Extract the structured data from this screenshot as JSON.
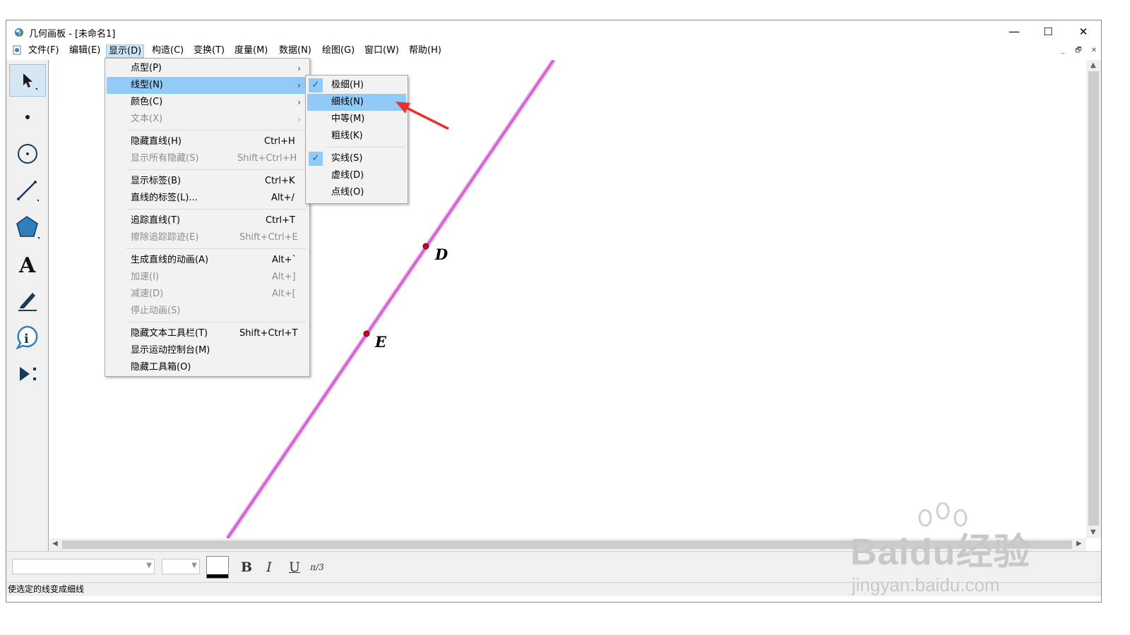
{
  "window": {
    "title": "几何画板 - [未命名1]"
  },
  "window_controls": {
    "minimize": "—",
    "maximize": "☐",
    "close": "✕"
  },
  "menubar": {
    "items": [
      "文件(F)",
      "编辑(E)",
      "显示(D)",
      "构造(C)",
      "变换(T)",
      "度量(M)",
      "数据(N)",
      "绘图(G)",
      "窗口(W)",
      "帮助(H)"
    ],
    "active_index": 2,
    "mdi_controls": [
      "_",
      "🗗",
      "✕"
    ]
  },
  "toolbox": {
    "tools": [
      "arrow-select-tool",
      "point-tool",
      "compass-tool",
      "straightedge-tool",
      "polygon-tool",
      "text-tool",
      "marker-tool",
      "information-tool",
      "custom-tool"
    ],
    "selected_index": 0
  },
  "display_menu": {
    "items": [
      {
        "label": "点型(P)",
        "shortcut": "",
        "submenu": true,
        "enabled": true
      },
      {
        "label": "线型(N)",
        "shortcut": "",
        "submenu": true,
        "enabled": true,
        "highlighted": true
      },
      {
        "label": "颜色(C)",
        "shortcut": "",
        "submenu": true,
        "enabled": true
      },
      {
        "label": "文本(X)",
        "shortcut": "",
        "submenu": true,
        "enabled": false
      },
      {
        "label": "隐藏直线(H)",
        "shortcut": "Ctrl+H",
        "enabled": true
      },
      {
        "label": "显示所有隐藏(S)",
        "shortcut": "Shift+Ctrl+H",
        "enabled": false
      },
      {
        "label": "显示标签(B)",
        "shortcut": "Ctrl+K",
        "enabled": true
      },
      {
        "label": "直线的标签(L)...",
        "shortcut": "Alt+/",
        "enabled": true
      },
      {
        "label": "追踪直线(T)",
        "shortcut": "Ctrl+T",
        "enabled": true
      },
      {
        "label": "擦除追踪踪迹(E)",
        "shortcut": "Shift+Ctrl+E",
        "enabled": false
      },
      {
        "label": "生成直线的动画(A)",
        "shortcut": "Alt+`",
        "enabled": true
      },
      {
        "label": "加速(I)",
        "shortcut": "Alt+]",
        "enabled": false
      },
      {
        "label": "减速(D)",
        "shortcut": "Alt+[",
        "enabled": false
      },
      {
        "label": "停止动画(S)",
        "shortcut": "",
        "enabled": false
      },
      {
        "label": "隐藏文本工具栏(T)",
        "shortcut": "Shift+Ctrl+T",
        "enabled": true
      },
      {
        "label": "显示运动控制台(M)",
        "shortcut": "",
        "enabled": true
      },
      {
        "label": "隐藏工具箱(O)",
        "shortcut": "",
        "enabled": true
      }
    ]
  },
  "line_style_submenu": {
    "items": [
      {
        "label": "极细(H)",
        "checked": true
      },
      {
        "label": "细线(N)",
        "checked": false,
        "highlighted": true
      },
      {
        "label": "中等(M)",
        "checked": false
      },
      {
        "label": "粗线(K)",
        "checked": false
      },
      {
        "label": "实线(S)",
        "checked": true
      },
      {
        "label": "虚线(D)",
        "checked": false
      },
      {
        "label": "点线(O)",
        "checked": false
      }
    ],
    "check_mark": "✓"
  },
  "canvas": {
    "points": [
      {
        "label": "D"
      },
      {
        "label": "E"
      }
    ],
    "line_color": "#e88ee8",
    "point_color": "#d0001c"
  },
  "text_toolbar": {
    "bold": "B",
    "italic": "I",
    "underline": "U",
    "math_format": "π/3"
  },
  "status": {
    "text": "使选定的线变成细线"
  },
  "watermark": {
    "brand": "Baidu经验",
    "url": "jingyan.baidu.com"
  },
  "annotation_arrow_color": "#e8302a"
}
